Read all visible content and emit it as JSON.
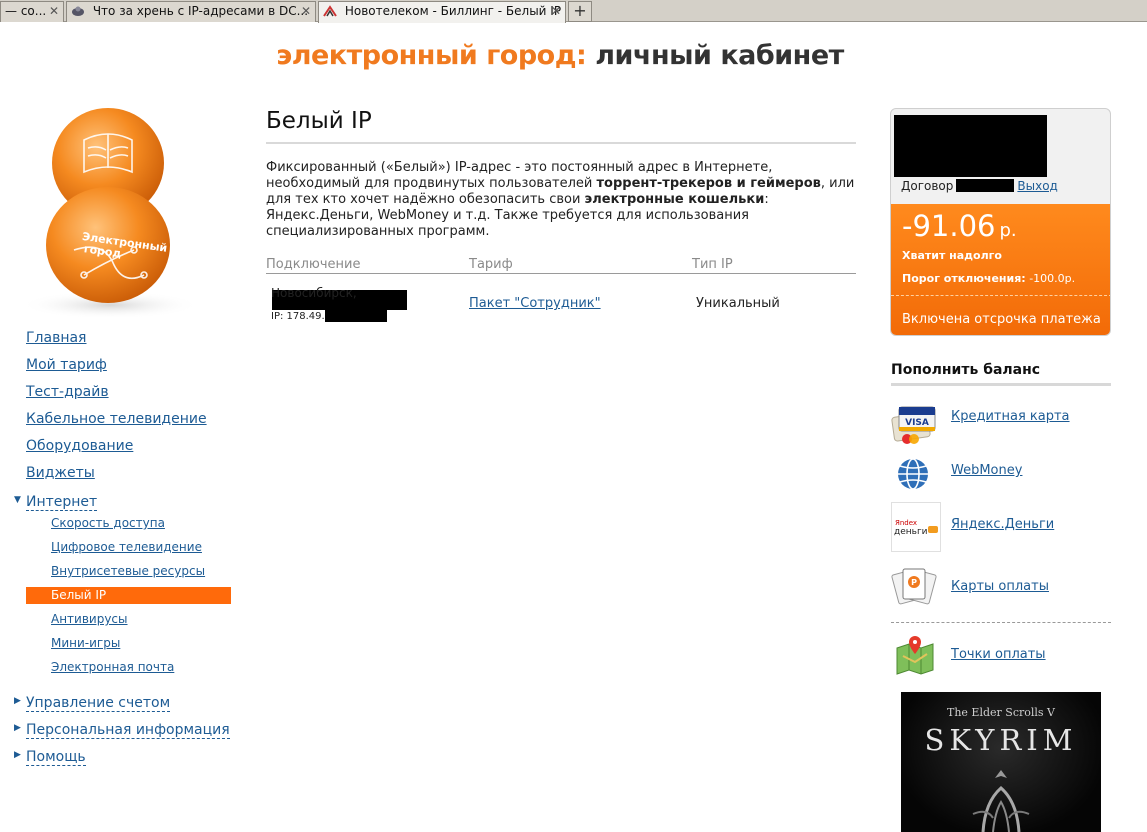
{
  "browser": {
    "tabs": [
      {
        "label": "— со...",
        "active": false
      },
      {
        "label": "Что за хрень с IP-адресами в DC...",
        "active": false
      },
      {
        "label": "Новотелеком - Биллинг - Белый IP",
        "active": true
      }
    ],
    "new_tab_label": "+"
  },
  "header": {
    "brand": "электронный город:",
    "subtitle": "личный кабинет"
  },
  "logo": {
    "text_line1": "Электронный",
    "text_line2": "город"
  },
  "nav": {
    "items": [
      {
        "label": "Главная"
      },
      {
        "label": "Мой тариф"
      },
      {
        "label": "Тест-драйв"
      },
      {
        "label": "Кабельное телевидение"
      },
      {
        "label": "Оборудование"
      },
      {
        "label": "Виджеты"
      },
      {
        "label": "Интернет"
      }
    ],
    "internet_sub": [
      {
        "label": "Скорость доступа"
      },
      {
        "label": "Цифровое телевидение"
      },
      {
        "label": "Внутрисетевые ресурсы"
      },
      {
        "label": "Белый IP"
      },
      {
        "label": "Антивирусы"
      },
      {
        "label": "Мини-игры"
      },
      {
        "label": "Электронная почта"
      }
    ],
    "collapsed": [
      {
        "label": "Управление счетом"
      },
      {
        "label": "Персональная информация"
      },
      {
        "label": "Помощь"
      }
    ]
  },
  "main": {
    "title": "Белый IP",
    "intro": {
      "p1": "Фиксированный («Белый») IP-адрес - это постоянный адрес в Интернете, необходимый для продвинутых пользователей ",
      "b1": "торрент-трекеров и геймеров",
      "p2": ", или для тех кто хочет надёжно обезопасить свои ",
      "b2": "электронные кошельки",
      "p3": ": Яндекс.Деньги, WebMoney и т.д. Также требуется для использования специализированных программ."
    },
    "table": {
      "headers": [
        "Подключение",
        "Тариф",
        "Тип IP"
      ],
      "rows": [
        {
          "connection": "Новосибирск,",
          "ip": "IP: 178.49.",
          "tariff": "Пакет \"Сотрудник\"",
          "ip_type": "Уникальный"
        }
      ]
    }
  },
  "account": {
    "contract_label": "Договор",
    "logout_label": "Выход",
    "balance": "-91.06",
    "currency": "р.",
    "status": "Хватит надолго",
    "limit_label": "Порог отключения:",
    "limit_value": "-100.0р.",
    "deferred": "Включена отсрочка платежа",
    "colors": {
      "accent": "#ff6a0b",
      "link": "#1d5b94"
    }
  },
  "topup": {
    "title": "Пополнить баланс",
    "methods": [
      {
        "label": "Кредитная карта",
        "icon": "credit-card-icon"
      },
      {
        "label": "WebMoney",
        "icon": "webmoney-icon"
      },
      {
        "label": "Яндекс.Деньги",
        "icon": "yandex-money-icon"
      },
      {
        "label": "Карты оплаты",
        "icon": "payment-cards-icon"
      }
    ],
    "points": {
      "label": "Точки оплаты",
      "icon": "map-pin-icon"
    }
  },
  "banner": {
    "sub": "The Elder Scrolls V",
    "main": "SKYRIM"
  }
}
